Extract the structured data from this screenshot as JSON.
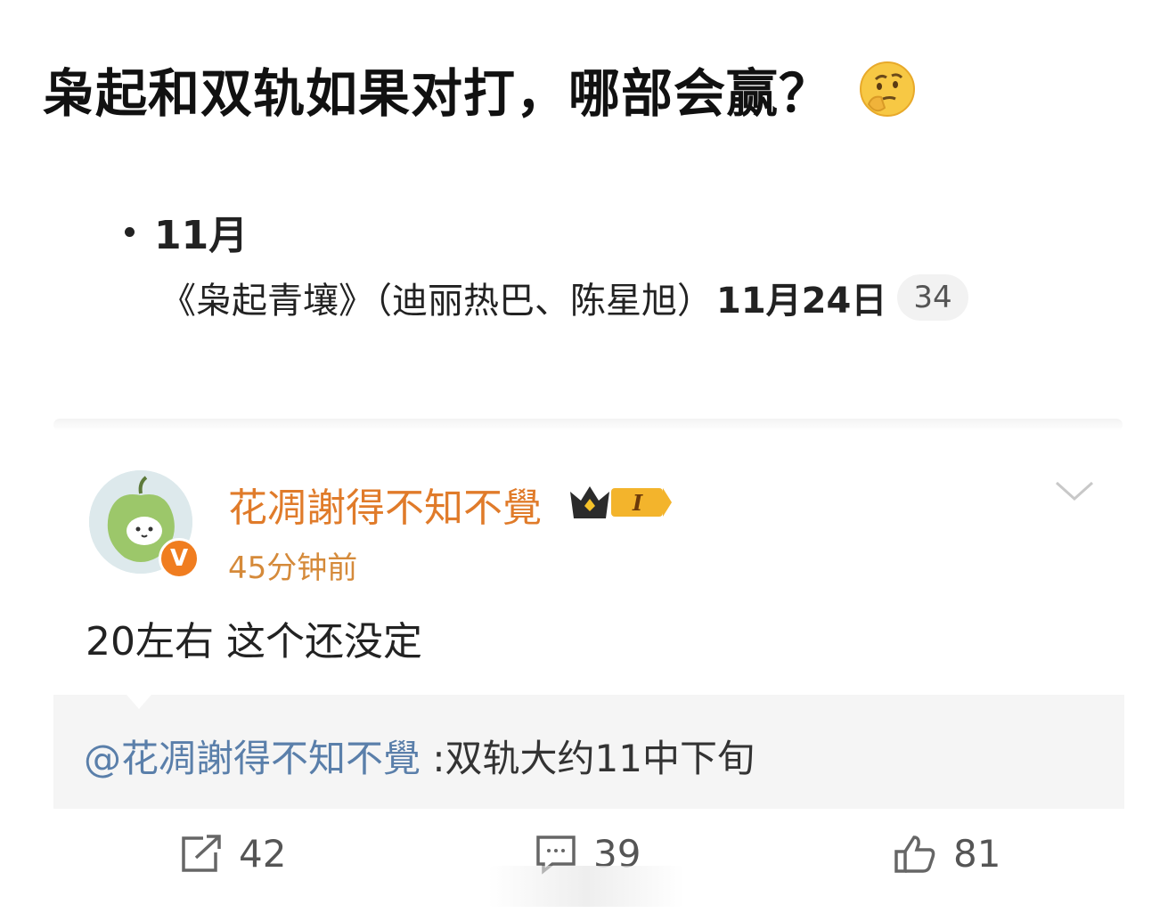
{
  "headline": {
    "text": "枭起和双轨如果对打，哪部会赢？",
    "emoji_icon": "thinking-face-icon"
  },
  "schedule": {
    "month": "11月",
    "show_title": "《枭起青壤》（迪丽热巴、陈星旭）",
    "show_date": "11月24日",
    "count": "34"
  },
  "comment": {
    "username": "花凋謝得不知不覺",
    "badge_level": "I",
    "time": "45分钟前",
    "text": "20左右 这个还没定",
    "reply_mention": "@花凋謝得不知不覺",
    "reply_text": ":双轨大约11中下旬",
    "verified_mark": "V"
  },
  "actions": {
    "share_count": "42",
    "comment_count": "39",
    "like_count": "81"
  },
  "colors": {
    "username": "#e07b2a",
    "time": "#d58a3a",
    "mention": "#5a7faa",
    "verified": "#f07d20"
  }
}
